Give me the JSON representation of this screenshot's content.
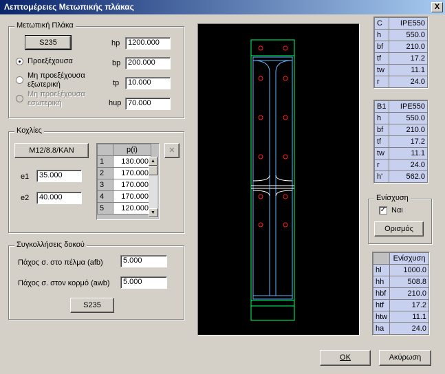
{
  "window": {
    "title": "Λεπτομέρειες Μετωπικής πλάκας",
    "close": "X"
  },
  "plate": {
    "group_label": "Μετωπική Πλάκα",
    "material_button": "S235",
    "radio_1": "Προεξέχουσα",
    "radio_2": "Μη προεξέχουσα εξωτερική",
    "radio_3": "Μη προεξέχουσα εσωτερική",
    "hp_label": "hp",
    "hp_value": "1200.000",
    "bp_label": "bp",
    "bp_value": "200.000",
    "tp_label": "tp",
    "tp_value": "10.000",
    "hup_label": "hup",
    "hup_value": "70.000"
  },
  "bolts": {
    "group_label": "Κοχλίες",
    "bolt_button": "M12/8.8/KAN",
    "e1_label": "e1",
    "e1_value": "35.000",
    "e2_label": "e2",
    "e2_value": "40.000",
    "table_header": "p(i)",
    "rows": [
      {
        "n": "1",
        "v": "130.000"
      },
      {
        "n": "2",
        "v": "170.000"
      },
      {
        "n": "3",
        "v": "170.000"
      },
      {
        "n": "4",
        "v": "170.000"
      },
      {
        "n": "5",
        "v": "120.000"
      }
    ],
    "delete": "✕"
  },
  "welds": {
    "group_label": "Συγκολλήσεις δοκού",
    "afb_label": "Πάχος σ. στο πέλμα (afb)",
    "afb_value": "5.000",
    "awb_label": "Πάχος σ. στον κορμό (awb)",
    "awb_value": "5.000",
    "material_button": "S235"
  },
  "column_profile": {
    "header": [
      "C",
      "IPE550"
    ],
    "rows": [
      [
        "h",
        "550.0"
      ],
      [
        "bf",
        "210.0"
      ],
      [
        "tf",
        "17.2"
      ],
      [
        "tw",
        "11.1"
      ],
      [
        "r",
        "24.0"
      ]
    ]
  },
  "beam_profile": {
    "header": [
      "B1",
      "IPE550"
    ],
    "rows": [
      [
        "h",
        "550.0"
      ],
      [
        "bf",
        "210.0"
      ],
      [
        "tf",
        "17.2"
      ],
      [
        "tw",
        "11.1"
      ],
      [
        "r",
        "24.0"
      ],
      [
        "h'",
        "562.0"
      ]
    ]
  },
  "haunch": {
    "group_label": "Ενίσχυση",
    "checkbox_label": "Ναι",
    "define_button": "Ορισμός",
    "table_header": "Ενίσχυση",
    "rows": [
      [
        "hl",
        "1000.0"
      ],
      [
        "hh",
        "508.8"
      ],
      [
        "hbf",
        "210.0"
      ],
      [
        "htf",
        "17.2"
      ],
      [
        "htw",
        "11.1"
      ],
      [
        "ha",
        "24.0"
      ]
    ]
  },
  "footer": {
    "ok": "OK",
    "cancel": "Ακύρωση"
  }
}
